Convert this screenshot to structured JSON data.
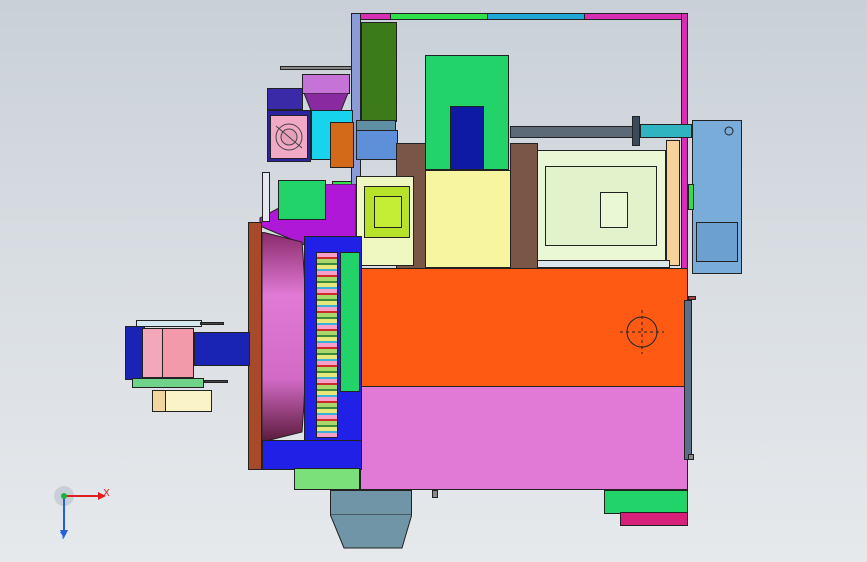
{
  "colors": {
    "background_top": "#c9d0d7",
    "background_bottom": "#e6e9ec",
    "orange_housing": "#ff5a14",
    "pink_housing": "#e07ad6",
    "green_block": "#22d36a",
    "yellow_block": "#f8f5a0",
    "brown_block": "#7a5646",
    "magenta_frame": "#d72fb4",
    "sky_blue_panel": "#79acd9",
    "navy_blue": "#0e1aa3",
    "axis_x": "#e02020",
    "axis_y": "#2060e0",
    "axis_z": "#20b040"
  },
  "triad": {
    "x_label": "X",
    "y_label": "Y"
  }
}
